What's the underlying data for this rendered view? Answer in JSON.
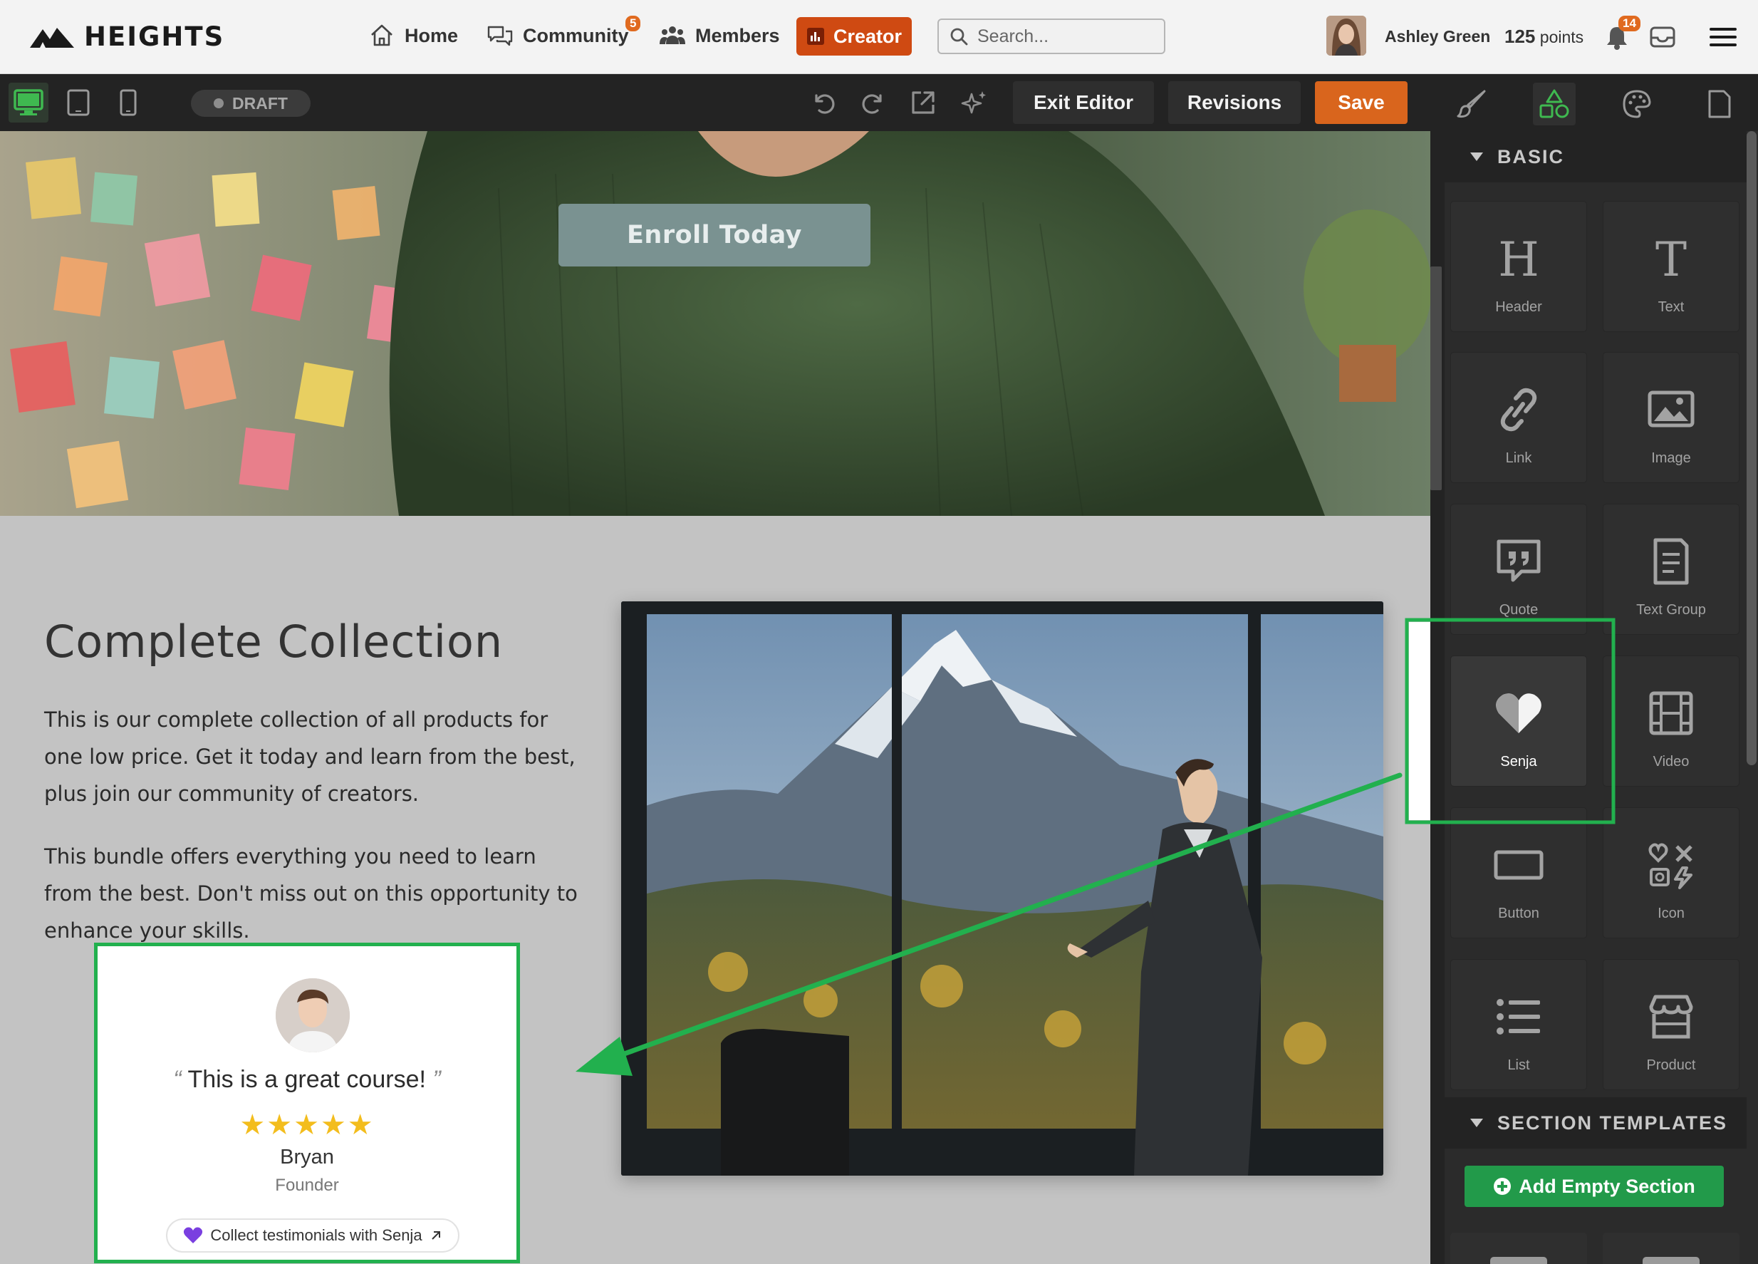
{
  "app": {
    "brand": "HEIGHTS"
  },
  "nav": {
    "home": "Home",
    "community": "Community",
    "community_badge": "5",
    "members": "Members",
    "creator": "Creator",
    "search_placeholder": "Search..."
  },
  "user": {
    "name": "Ashley Green",
    "points_value": "125",
    "points_label": "points",
    "notifications": "14"
  },
  "toolbar": {
    "status": "DRAFT",
    "exit_editor": "Exit Editor",
    "revisions": "Revisions",
    "save": "Save"
  },
  "page": {
    "hero_button": "Enroll Today",
    "section_title": "Complete Collection",
    "para1_lines": [
      "This is our complete collection of all products for",
      "one low price. Get it today and learn from the best,",
      "plus join our community of creators."
    ],
    "para2_lines": [
      "This bundle offers everything you need to learn",
      "from the best. Don't miss out on this opportunity to",
      "enhance your skills."
    ],
    "testimonial": {
      "quote_open": "“",
      "quote": "This is a great course!",
      "quote_close": "”",
      "stars": "★★★★★",
      "rating": 5,
      "name": "Bryan",
      "role": "Founder",
      "collect": "Collect testimonials with Senja"
    }
  },
  "panel": {
    "basic_heading": "BASIC",
    "templates_heading": "SECTION TEMPLATES",
    "add_empty_section": "Add Empty Section",
    "tiles": [
      {
        "label": "Header",
        "icon": "header-icon"
      },
      {
        "label": "Text",
        "icon": "text-icon"
      },
      {
        "label": "Link",
        "icon": "link-icon"
      },
      {
        "label": "Image",
        "icon": "image-icon"
      },
      {
        "label": "Quote",
        "icon": "quote-icon"
      },
      {
        "label": "Text Group",
        "icon": "text-group-icon"
      },
      {
        "label": "Senja",
        "icon": "heart-icon"
      },
      {
        "label": "Video",
        "icon": "film-icon"
      },
      {
        "label": "Button",
        "icon": "button-icon"
      },
      {
        "label": "Icon",
        "icon": "shapes-icon"
      },
      {
        "label": "List",
        "icon": "list-icon"
      },
      {
        "label": "Product",
        "icon": "store-icon"
      }
    ]
  },
  "colors": {
    "accent_orange": "#d9651d",
    "creator_orange": "#cf4a12",
    "highlight_green": "#22b04e",
    "add_section_green": "#229a4a",
    "star_yellow": "#f3bd1d"
  }
}
